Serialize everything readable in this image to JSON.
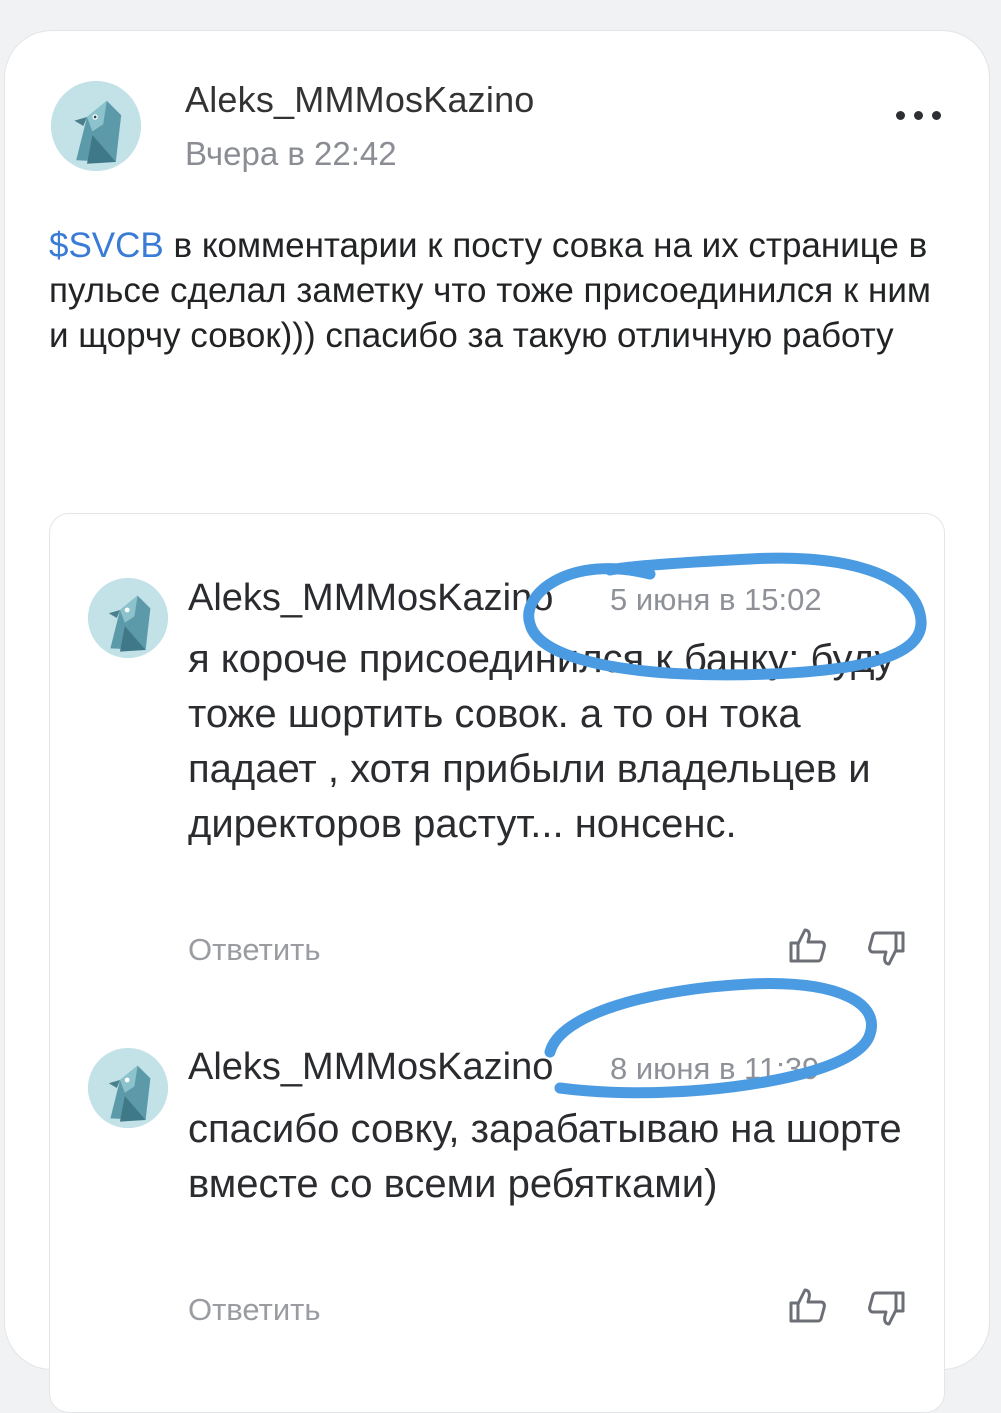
{
  "post": {
    "author": "Aleks_MMMosKazino",
    "time": "Вчера в 22:42",
    "ticker": "$SVCB",
    "text": " в комментарии к посту совка на их странице в пульсе сделал заметку что тоже присоединился к ним и щорчу совок))) спасибо за такую отличную работу",
    "more_icon": "more-dots-icon"
  },
  "embedded_comments": [
    {
      "author": "Aleks_MMMosKazino",
      "date": "5 июня в 15:02",
      "text": "я  короче присоединился к банку: буду тоже шортить совок. а то он тока падает  , хотя прибыли владельцев и директоров растут... нонсенс.",
      "reply_label": "Ответить"
    },
    {
      "author": "Aleks_MMMosKazino",
      "date": "8 июня в 11:39",
      "text": "спасибо совку, зарабатываю на шорте вместе со всеми ребятками)",
      "reply_label": "Ответить"
    }
  ],
  "colors": {
    "ticker": "#3a7bd5",
    "scribble": "#4b9be3",
    "avatar_bg": "#bfe0e6"
  }
}
